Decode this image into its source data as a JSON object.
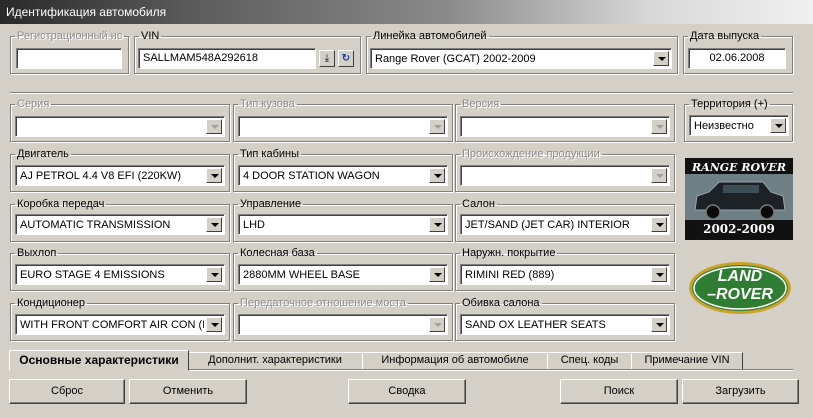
{
  "window": {
    "title": "Идентификация автомобиля"
  },
  "top": {
    "reg": {
      "label": "Регистрационный нс",
      "value": ""
    },
    "vin": {
      "label": "VIN",
      "value": "SALLMAM548A292618"
    },
    "line": {
      "label": "Линейка автомобилей",
      "value": "Range Rover (GCAT) 2002-2009"
    },
    "date": {
      "label": "Дата выпуска",
      "value": "02.06.2008"
    }
  },
  "fields": {
    "series": {
      "label": "Серия",
      "value": ""
    },
    "body": {
      "label": "Тип кузова",
      "value": ""
    },
    "version": {
      "label": "Версия",
      "value": ""
    },
    "territory": {
      "label": "Территория (+)",
      "value": "Неизвестно"
    },
    "engine": {
      "label": "Двигатель",
      "value": "AJ PETROL 4.4 V8 EFI (220KW)"
    },
    "cab": {
      "label": "Тип кабины",
      "value": "4 DOOR STATION WAGON"
    },
    "origin": {
      "label": "Происхождение продукции",
      "value": ""
    },
    "gearbox": {
      "label": "Коробка передач",
      "value": "AUTOMATIC TRANSMISSION"
    },
    "steering": {
      "label": "Управление",
      "value": "LHD"
    },
    "interior": {
      "label": "Салон",
      "value": "JET/SAND (JET CAR) INTERIOR"
    },
    "exhaust": {
      "label": "Выхлоп",
      "value": "EURO STAGE 4 EMISSIONS"
    },
    "wheelbase": {
      "label": "Колесная база",
      "value": "2880MM WHEEL BASE"
    },
    "paint": {
      "label": "Наружн. покрытие",
      "value": "RIMINI RED (889)"
    },
    "aircon": {
      "label": "Кондиционер",
      "value": "WITH FRONT COMFORT AIR CON (IH"
    },
    "axle": {
      "label": "Передаточное отношение моста",
      "value": ""
    },
    "trim": {
      "label": "Обивка салона",
      "value": "SAND OX LEATHER SEATS"
    }
  },
  "images": {
    "rr_title": "RANGE ROVER",
    "rr_years": "2002-2009",
    "logo_line1": "LAND",
    "logo_line2": "ROVER"
  },
  "tabs": [
    "Основные характеристики",
    "Дополнит. характеристики",
    "Информация об автомобиле",
    "Спец. коды",
    "Примечание VIN"
  ],
  "buttons": {
    "reset": "Сброс",
    "cancel": "Отменить",
    "summary": "Сводка",
    "search": "Поиск",
    "load": "Загрузить"
  },
  "icons": {
    "dropdown": "chevron-down-icon",
    "vin_load": "download-arrow-icon",
    "vin_refresh": "refresh-icon"
  },
  "colors": {
    "dialog_bg": "#d4d0c8",
    "logo_green": "#2f7d32",
    "logo_rim": "#c9a227"
  }
}
